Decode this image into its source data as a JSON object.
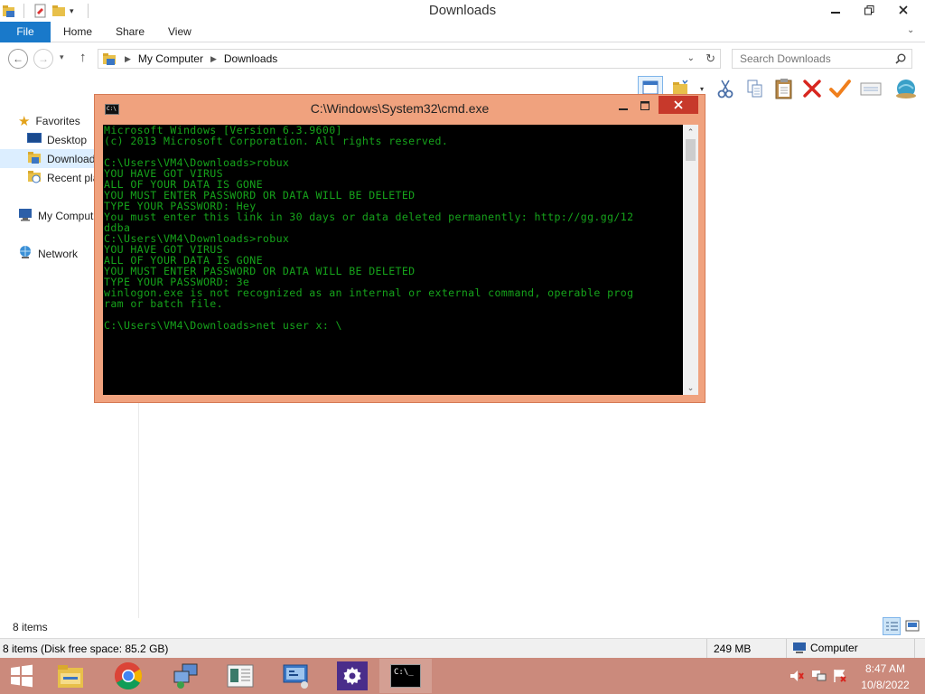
{
  "explorer": {
    "window_title": "Downloads",
    "tabs": {
      "file": "File",
      "home": "Home",
      "share": "Share",
      "view": "View"
    },
    "address": {
      "root": "My Computer",
      "current": "Downloads"
    },
    "search_placeholder": "Search Downloads",
    "nav_pane": {
      "favorites": "Favorites",
      "desktop": "Desktop",
      "downloads": "Download",
      "recent": "Recent pla",
      "computer": "My Comput",
      "network": "Network"
    },
    "item_count": "8 items",
    "status": {
      "items": "8 items (Disk free space: 85.2 GB)",
      "size": "249 MB",
      "location": "Computer"
    },
    "icons": [
      "back-icon",
      "forward-icon",
      "up-icon",
      "refresh-icon",
      "search-icon",
      "cut-icon",
      "copy-icon",
      "paste-icon",
      "delete-icon",
      "check-icon"
    ]
  },
  "cmd": {
    "title": "C:\\Windows\\System32\\cmd.exe",
    "lines": [
      "Microsoft Windows [Version 6.3.9600]",
      "(c) 2013 Microsoft Corporation. All rights reserved.",
      "",
      "C:\\Users\\VM4\\Downloads>robux",
      "YOU HAVE GOT VIRUS",
      "ALL OF YOUR DATA IS GONE",
      "YOU MUST ENTER PASSWORD OR DATA WILL BE DELETED",
      "TYPE YOUR PASSWORD: Hey",
      "You must enter this link in 30 days or data deleted permanently: http://gg.gg/12",
      "ddba",
      "C:\\Users\\VM4\\Downloads>robux",
      "YOU HAVE GOT VIRUS",
      "ALL OF YOUR DATA IS GONE",
      "YOU MUST ENTER PASSWORD OR DATA WILL BE DELETED",
      "TYPE YOUR PASSWORD: 3e",
      "winlogon.exe is not recognized as an internal or external command, operable prog",
      "ram or batch file.",
      "",
      "C:\\Users\\VM4\\Downloads>net user x: \\"
    ]
  },
  "taskbar": {
    "time": "8:47 AM",
    "date": "10/8/2022",
    "cmd_label": "C:\\_"
  },
  "colors": {
    "taskbar": "#cb8a7c",
    "cmd_frame": "#f0a27e",
    "console_text": "#16a31b",
    "file_tab": "#1979ca"
  }
}
